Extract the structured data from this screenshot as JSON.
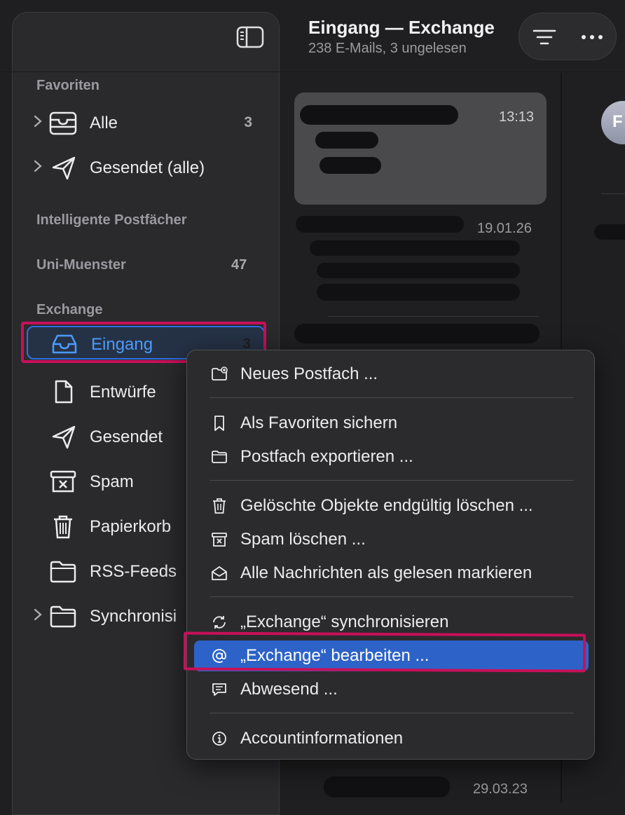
{
  "header": {
    "title": "Eingang — Exchange",
    "subtitle": "238 E-Mails, 3 ungelesen"
  },
  "sidebar": {
    "sections": {
      "favorites": "Favoriten",
      "smart": "Intelligente Postfächer",
      "uni": "Uni-Muenster",
      "uni_count": "47",
      "exchange": "Exchange"
    },
    "favorites": [
      {
        "label": "Alle",
        "count": "3",
        "icon": "tray-icon"
      },
      {
        "label": "Gesendet (alle)",
        "count": "",
        "icon": "paperplane-icon"
      }
    ],
    "exchange": [
      {
        "label": "Eingang",
        "count": "3",
        "icon": "inbox-icon",
        "selected": true
      },
      {
        "label": "Entwürfe",
        "count": "",
        "icon": "document-icon"
      },
      {
        "label": "Gesendet",
        "count": "",
        "icon": "paperplane-icon"
      },
      {
        "label": "Spam",
        "count": "",
        "icon": "junk-icon"
      },
      {
        "label": "Papierkorb",
        "count": "",
        "icon": "trash-icon"
      },
      {
        "label": "RSS-Feeds",
        "count": "",
        "icon": "folder-icon"
      },
      {
        "label": "Synchronisi",
        "count": "",
        "icon": "folder-icon"
      }
    ]
  },
  "messages": {
    "times": [
      "13:13",
      "19.01.26",
      "29.03.23"
    ]
  },
  "avatar": {
    "initial": "F"
  },
  "context_menu": {
    "items": [
      {
        "label": "Neues Postfach ...",
        "icon": "new-folder-icon"
      },
      {
        "label": "Als Favoriten sichern",
        "icon": "bookmark-icon"
      },
      {
        "label": "Postfach exportieren ...",
        "icon": "folder-icon"
      },
      {
        "label": "Gelöschte Objekte endgültig löschen ...",
        "icon": "trash-icon"
      },
      {
        "label": "Spam löschen ...",
        "icon": "junk-icon"
      },
      {
        "label": "Alle Nachrichten als gelesen markieren",
        "icon": "open-envelope-icon"
      },
      {
        "label": "„Exchange“ synchronisieren",
        "icon": "sync-icon"
      },
      {
        "label": "„Exchange“ bearbeiten ...",
        "icon": "at-icon",
        "active": true
      },
      {
        "label": "Abwesend ...",
        "icon": "message-bubble-icon"
      },
      {
        "label": "Accountinformationen",
        "icon": "info-icon"
      }
    ]
  },
  "colors": {
    "accent": "#2d63c8",
    "selection_text": "#4a9bff",
    "annotation": "#c8105a"
  }
}
